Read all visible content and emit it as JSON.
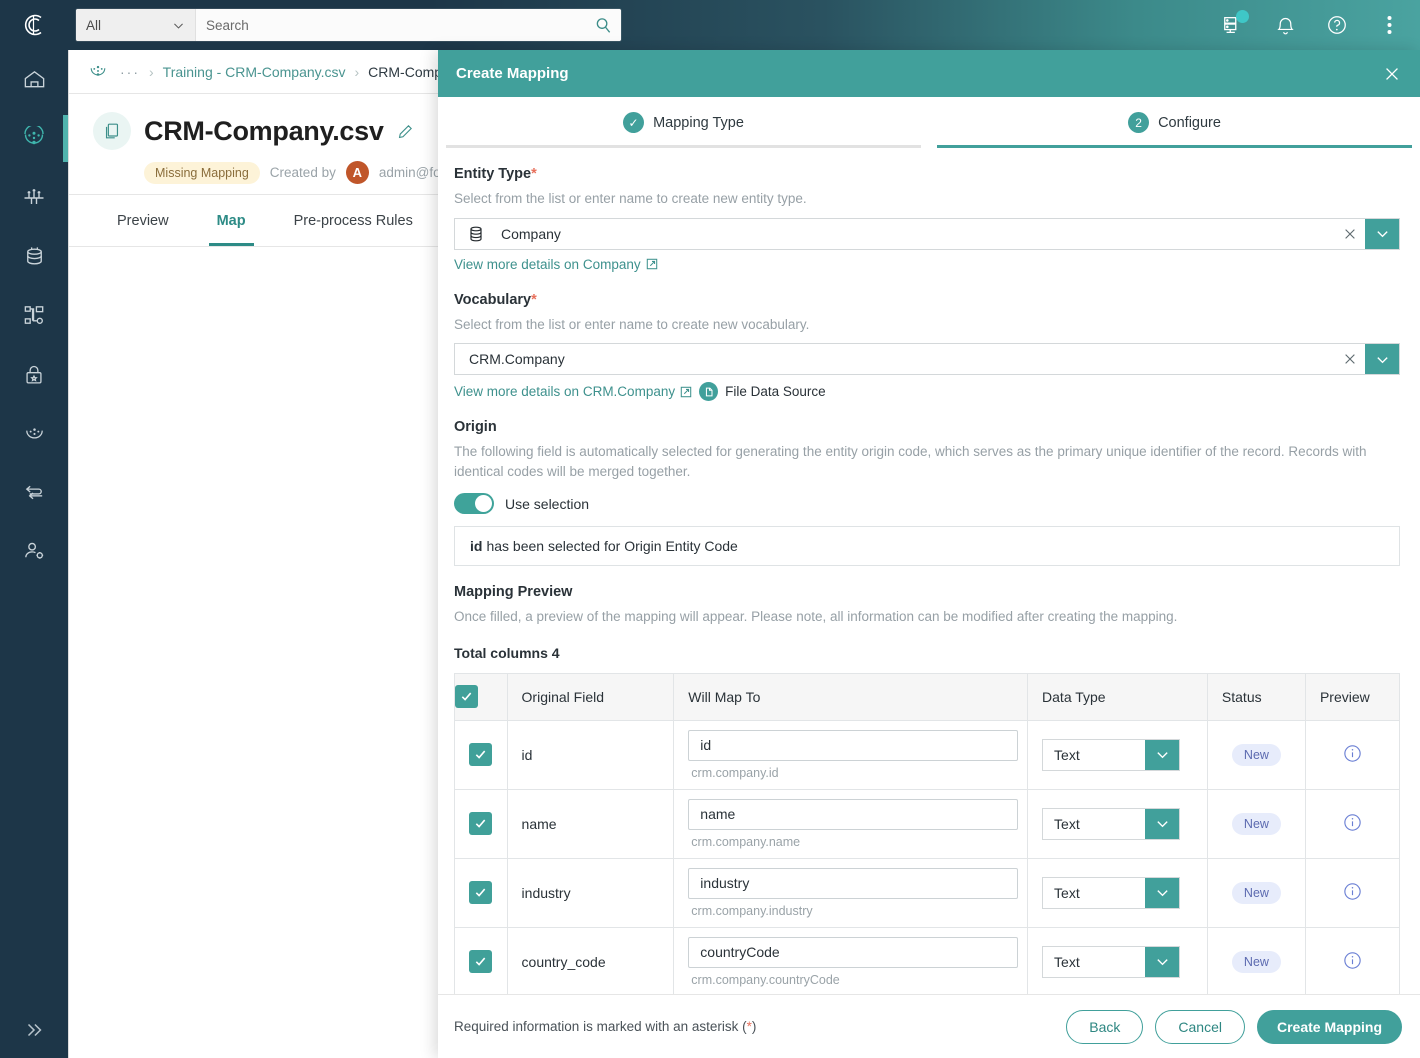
{
  "topbar": {
    "logo_icon": "clearc-logo-icon",
    "scope_value": "All",
    "scope_icon": "chevron-down-icon",
    "search_placeholder": "Search",
    "search_value": "",
    "search_icon": "search-icon",
    "icons": [
      {
        "name": "server-status-icon",
        "badge": true
      },
      {
        "name": "bell-notification-icon",
        "badge": false
      },
      {
        "name": "help-circle-icon",
        "badge": false
      },
      {
        "name": "kebab-menu-icon",
        "badge": false
      }
    ],
    "accent_teal": "#3fc7c7",
    "bg_left": "#1d3648",
    "bg_right": "#4aa3a0"
  },
  "leftnav": {
    "items": [
      {
        "name": "home-icon",
        "active": false
      },
      {
        "name": "data-sources-icon",
        "active": true
      },
      {
        "name": "streams-icon",
        "active": false
      },
      {
        "name": "database-icon",
        "active": false
      },
      {
        "name": "topology-icon",
        "active": false
      },
      {
        "name": "security-lock-icon",
        "active": false
      },
      {
        "name": "governance-icon",
        "active": false
      },
      {
        "name": "deduplication-icon",
        "active": false
      },
      {
        "name": "user-settings-icon",
        "active": false
      }
    ],
    "collapse_icon": "double-chevron-right-icon",
    "active_marker_color": "#4fb3ad"
  },
  "breadcrumb": {
    "logo_icon": "data-sources-icon",
    "dots": "···",
    "separator": "›",
    "items": [
      {
        "label": "Training - CRM-Company.csv",
        "current": false
      },
      {
        "label": "CRM-Comp",
        "current": true
      }
    ]
  },
  "page": {
    "doc_icon": "file-copy-icon",
    "title": "CRM-Company.csv",
    "edit_icon": "pencil-edit-icon",
    "status_chip": "Missing Mapping",
    "created_by_label": "Created by",
    "avatar_initial": "A",
    "created_by_user": "admin@fool",
    "tabs": [
      {
        "label": "Preview",
        "active": false
      },
      {
        "label": "Map",
        "active": true
      },
      {
        "label": "Pre-process Rules",
        "active": false
      }
    ]
  },
  "modal": {
    "title": "Create Mapping",
    "close_icon": "close-x-icon",
    "steps": [
      {
        "label": "Mapping Type",
        "marker": "✓",
        "active": false,
        "completed": true
      },
      {
        "label": "Configure",
        "marker": "2",
        "active": true,
        "completed": false
      }
    ],
    "entity_type": {
      "label": "Entity Type",
      "required_mark": "*",
      "help": "Select from the list or enter name to create new entity type.",
      "icon": "database-stack-icon",
      "value": "Company",
      "clear_icon": "clear-x-icon",
      "arrow_icon": "chevron-down-icon",
      "link_text": "View more details on Company",
      "link_icon": "external-link-icon"
    },
    "vocabulary": {
      "label": "Vocabulary",
      "required_mark": "*",
      "help": "Select from the list or enter name to create new vocabulary.",
      "value": "CRM.Company",
      "clear_icon": "clear-x-icon",
      "arrow_icon": "chevron-down-icon",
      "link_text": "View more details on CRM.Company",
      "link_icon": "external-link-icon",
      "source_badge_icon": "file-data-source-icon",
      "source_label": "File Data Source"
    },
    "origin": {
      "label": "Origin",
      "help": "The following field is automatically selected for generating the entity origin code, which serves as the primary unique identifier of the record. Records with identical codes will be merged together.",
      "toggle_label": "Use selection",
      "toggle_on": true,
      "selected_field": "id",
      "selected_text": "has been selected for Origin Entity Code"
    },
    "mapping_preview": {
      "label": "Mapping Preview",
      "help": "Once filled, a preview of the mapping will appear. Please note, all information can be modified after creating the mapping.",
      "total_columns": "Total columns 4"
    },
    "table": {
      "columns": [
        "",
        "Original Field",
        "Will Map To",
        "Data Type",
        "Status",
        "Preview"
      ],
      "header_checked": true,
      "rows": [
        {
          "checked": true,
          "original": "id",
          "map_to": "id",
          "path": "crm.company.id",
          "type": "Text",
          "status": "New",
          "preview_icon": "info-circle-icon"
        },
        {
          "checked": true,
          "original": "name",
          "map_to": "name",
          "path": "crm.company.name",
          "type": "Text",
          "status": "New",
          "preview_icon": "info-circle-icon"
        },
        {
          "checked": true,
          "original": "industry",
          "map_to": "industry",
          "path": "crm.company.industry",
          "type": "Text",
          "status": "New",
          "preview_icon": "info-circle-icon"
        },
        {
          "checked": true,
          "original": "country_code",
          "map_to": "countryCode",
          "path": "crm.company.countryCode",
          "type": "Text",
          "status": "New",
          "preview_icon": "info-circle-icon"
        }
      ]
    },
    "footer": {
      "note_before": "Required information is marked with an asterisk (",
      "note_mark": "*",
      "note_after": ")",
      "back_label": "Back",
      "cancel_label": "Cancel",
      "create_label": "Create Mapping"
    },
    "colors": {
      "teal": "#41a09b",
      "status_pill_bg": "#e7ecfb",
      "status_pill_fg": "#5c6ab0",
      "chip_bg": "#fdf3d8",
      "chip_fg": "#8a6d3b",
      "required": "#e8705c"
    }
  }
}
